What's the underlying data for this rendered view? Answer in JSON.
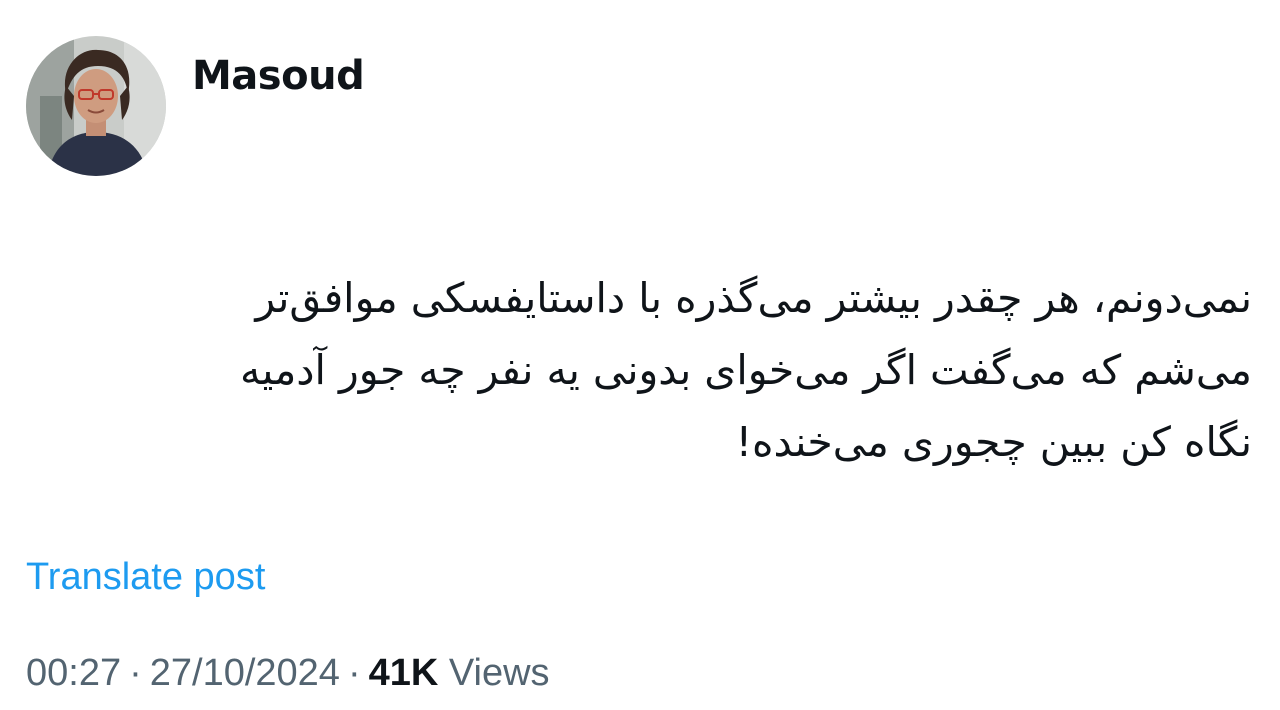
{
  "author": {
    "display_name": "Masoud",
    "avatar_icon": "user-avatar-photo"
  },
  "post": {
    "lines": [
      "نمی‌دونم، هر چقدر بیشتر می‌گذره با داستایفسکی موافق‌تر",
      "می‌شم که می‌گفت اگر می‌خوای بدونی یه نفر چه جور آدمیه",
      "نگاه کن ببین چجوری می‌خنده!"
    ],
    "translate_label": "Translate post"
  },
  "meta": {
    "time": "00:27",
    "separator": "·",
    "date": "27/10/2024",
    "views_count": "41K",
    "views_label": "Views"
  },
  "colors": {
    "link": "#1d9bf0",
    "text": "#0f1419",
    "secondary": "#536471"
  }
}
